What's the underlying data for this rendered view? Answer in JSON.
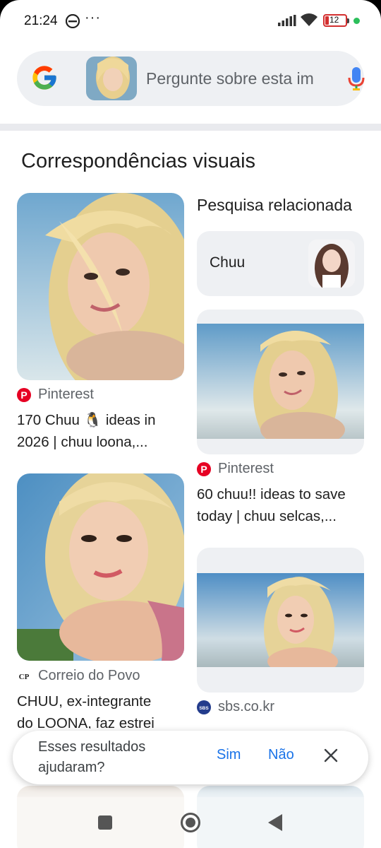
{
  "status_bar": {
    "time": "21:24",
    "more": "···",
    "battery_level": "12",
    "icons": [
      "app-e-icon",
      "signal-icon",
      "wifi-icon",
      "battery-icon",
      "privacy-dot-icon"
    ]
  },
  "search": {
    "placeholder": "Pergunte sobre esta im",
    "icons": [
      "google-logo-icon",
      "mic-icon"
    ]
  },
  "section_title": "Correspondências visuais",
  "related": {
    "title": "Pesquisa relacionada",
    "chip_label": "Chuu"
  },
  "results": [
    {
      "source": "Pinterest",
      "title_line1": "170 Chuu 🐧 ideas in",
      "title_line2": "2026 | chuu loona,..."
    },
    {
      "source": "Pinterest",
      "title_line1": "60 chuu!! ideas to save",
      "title_line2": "today | chuu selcas,..."
    },
    {
      "source": "Correio do Povo",
      "title_line1": "CHUU, ex-integrante",
      "title_line2": "do LOONA, faz estrei"
    },
    {
      "source": "sbs.co.kr",
      "title_line1": "",
      "title_line2": ""
    }
  ],
  "source_icons": {
    "pinterest": "P",
    "correio": "CP",
    "sbs": "SBS"
  },
  "feedback": {
    "question": "Esses resultados ajudaram?",
    "yes": "Sim",
    "no": "Não"
  },
  "colors": {
    "accent_blue": "#1a73e8",
    "pinterest_red": "#e60023",
    "search_bg": "#eef0f3",
    "battery_red": "#d32f2f"
  }
}
